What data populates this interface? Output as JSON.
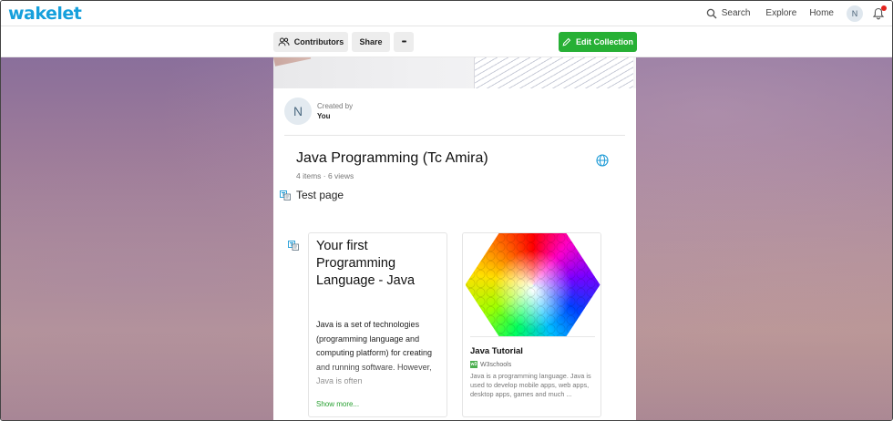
{
  "navbar": {
    "logo": "wakelet",
    "search_label": "Search",
    "explore_label": "Explore",
    "home_label": "Home",
    "avatar_initial": "N"
  },
  "toolbar": {
    "contributors_label": "Contributors",
    "share_label": "Share",
    "more_label": "•••",
    "edit_label": "Edit Collection"
  },
  "collection": {
    "created_caption": "Created by",
    "created_by": "You",
    "avatar_initial": "N",
    "title": "Java Programming (Tc Amira)",
    "meta": "4 items · 6 views"
  },
  "section": {
    "title": "Test page"
  },
  "items": [
    {
      "type": "text",
      "heading": "Your first Programming Language - Java",
      "body": "Java is a set of technologies (programming language and computing platform) for creating and running software. However, Java is often",
      "more_label": "Show more..."
    },
    {
      "type": "link",
      "title": "Java Tutorial",
      "source": "W3schools",
      "favicon_text": "w3",
      "description": "Java is a programming language. Java is used to develop mobile apps, web apps, desktop apps, games and much ..."
    }
  ],
  "colors": {
    "brand": "#16a0dc",
    "edit_button": "#27b035",
    "notification_dot": "#e3231d"
  }
}
